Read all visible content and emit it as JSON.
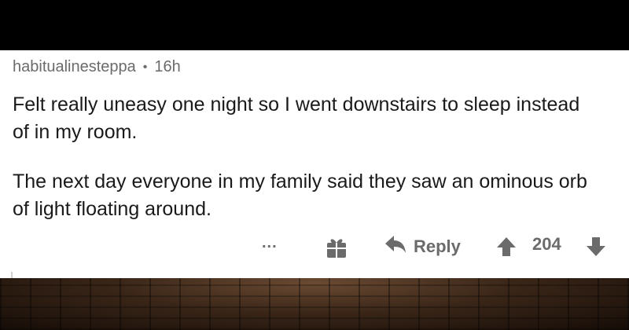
{
  "post": {
    "username": "habitualinesteppa",
    "separator": "•",
    "time": "16h",
    "paragraphs": [
      "Felt really uneasy one night so I went downstairs to sleep instead of in my room.",
      "The next day everyone in my family said they saw an ominous orb of light floating around."
    ]
  },
  "actions": {
    "more_label": "...",
    "gift_icon": "gift-icon",
    "reply_label": "Reply",
    "score": "204"
  },
  "colors": {
    "text": "#1a1a1b",
    "muted": "#6b6b6b",
    "card": "#ffffff",
    "frame": "#000000"
  }
}
